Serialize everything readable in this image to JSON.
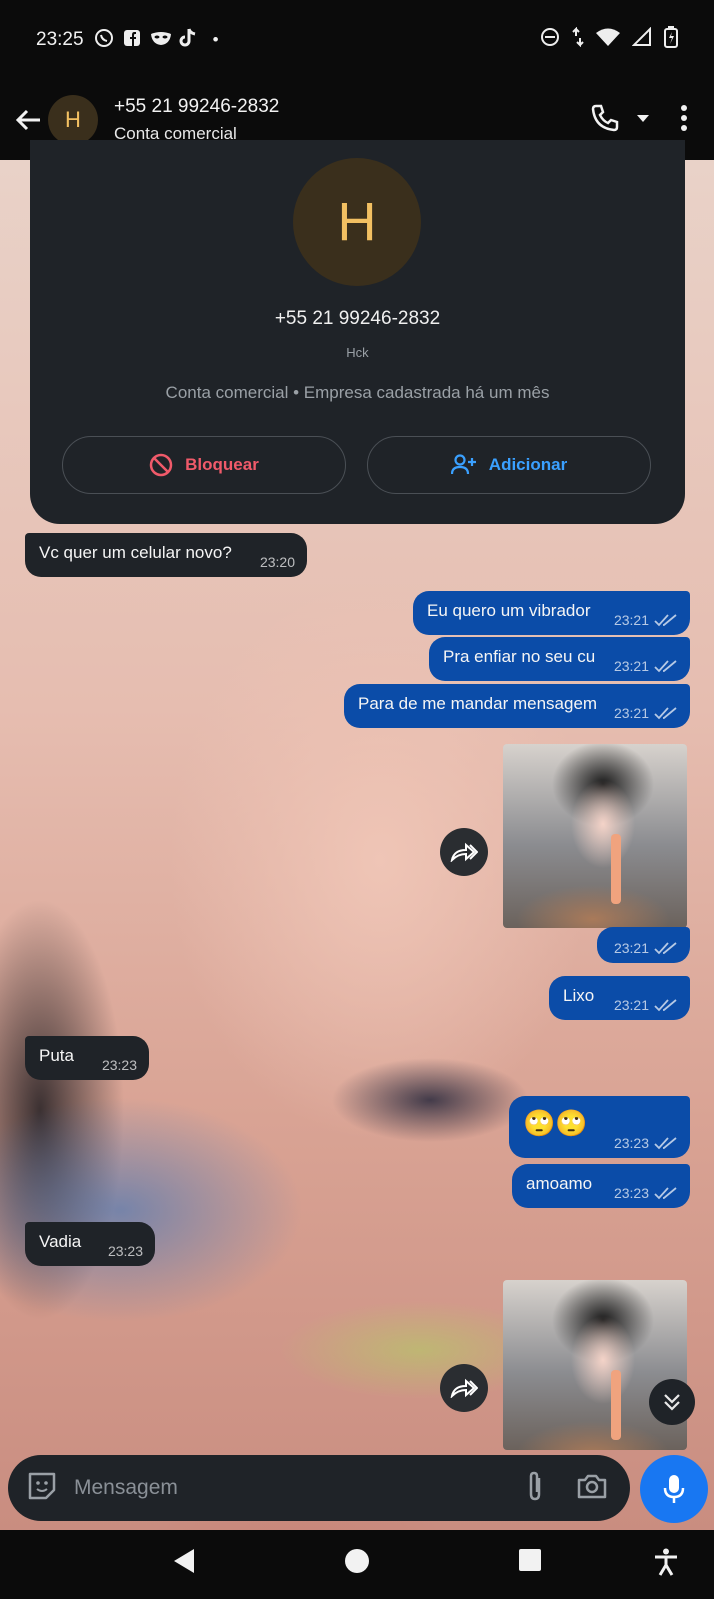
{
  "status_bar": {
    "time": "23:25",
    "notification_icons": [
      "whatsapp-icon",
      "facebook-icon",
      "mask-icon",
      "tiktok-icon"
    ],
    "dot": "•",
    "system_icons": [
      "dnd-icon",
      "data-arrows-icon",
      "wifi-icon",
      "signal-icon",
      "battery-icon"
    ]
  },
  "header": {
    "avatar_letter": "H",
    "title": "+55 21 99246-2832",
    "subtitle": "Conta comercial"
  },
  "business_card": {
    "avatar_letter": "H",
    "phone": "+55 21 99246-2832",
    "name": "Hck",
    "info": "Conta comercial • Empresa cadastrada há um mês",
    "block_label": "Bloquear",
    "add_label": "Adicionar"
  },
  "messages": [
    {
      "type": "in",
      "text": "Vc quer um celular novo?",
      "time": "23:20"
    },
    {
      "type": "out",
      "text": "Eu quero um vibrador",
      "time": "23:21"
    },
    {
      "type": "out",
      "text": "Pra enfiar no seu cu",
      "time": "23:21"
    },
    {
      "type": "out",
      "text": "Para de me mandar mensagem",
      "time": "23:21"
    },
    {
      "type": "out-image",
      "time": "23:21"
    },
    {
      "type": "out",
      "text": "Lixo",
      "time": "23:21"
    },
    {
      "type": "in",
      "text": "Puta",
      "time": "23:23"
    },
    {
      "type": "out",
      "text": "🙄🙄",
      "time": "23:23"
    },
    {
      "type": "out",
      "text": "amoamo",
      "time": "23:23"
    },
    {
      "type": "in",
      "text": "Vadia",
      "time": "23:23"
    },
    {
      "type": "out-image"
    }
  ],
  "composer": {
    "placeholder": "Mensagem"
  },
  "colors": {
    "outgoing_bubble": "#0b4ca8",
    "incoming_bubble": "#1f2328",
    "accent_blue": "#1877f2",
    "block_red": "#f05a6a",
    "avatar_letter": "#f2c062"
  }
}
